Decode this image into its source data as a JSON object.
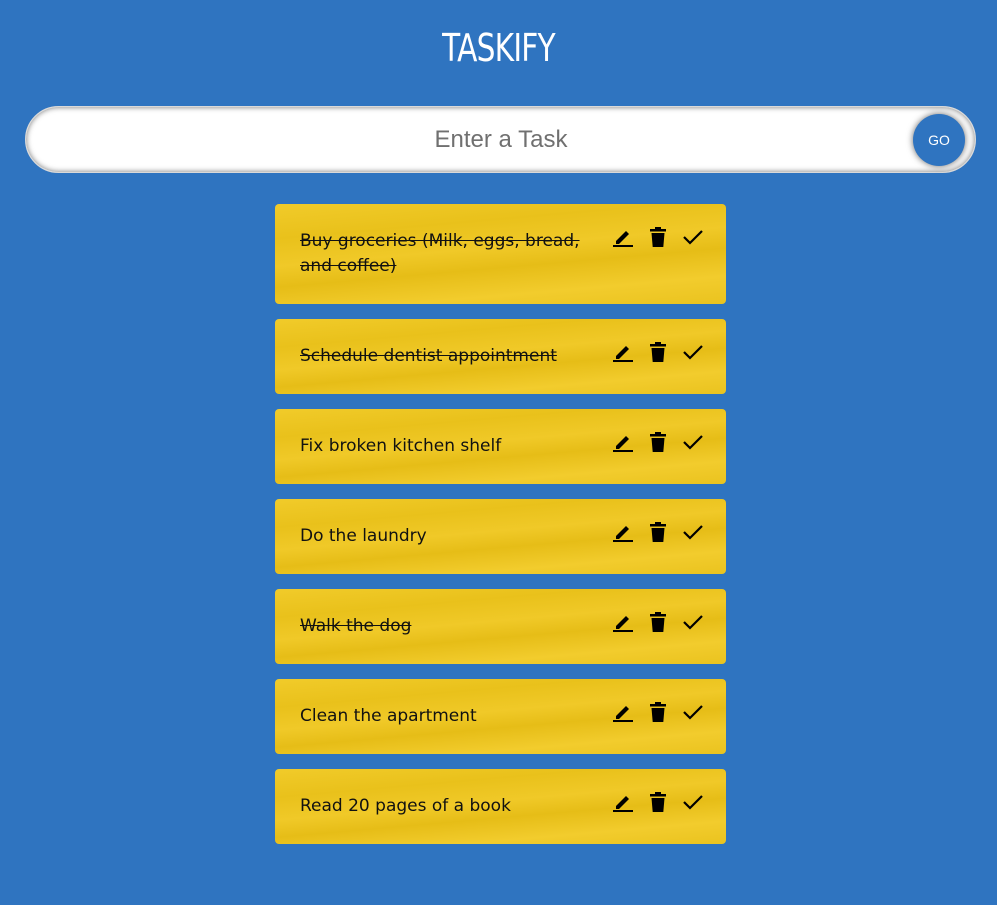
{
  "app": {
    "title": "TASKIFY"
  },
  "input": {
    "placeholder": "Enter a Task",
    "value": "",
    "submit_label": "GO"
  },
  "todos": [
    {
      "text": "Buy groceries (Milk, eggs, bread, and coffee)",
      "done": true
    },
    {
      "text": "Schedule dentist appointment",
      "done": true
    },
    {
      "text": "Fix broken kitchen shelf",
      "done": false
    },
    {
      "text": "Do the laundry",
      "done": false
    },
    {
      "text": "Walk the dog",
      "done": true
    },
    {
      "text": "Clean the apartment",
      "done": false
    },
    {
      "text": "Read 20 pages of a book",
      "done": false
    }
  ],
  "icons": {
    "edit": "edit-icon",
    "delete": "delete-icon",
    "done": "check-icon"
  },
  "colors": {
    "background": "#2f74c0",
    "card": "#f0c928",
    "button": "#2f74c0"
  }
}
